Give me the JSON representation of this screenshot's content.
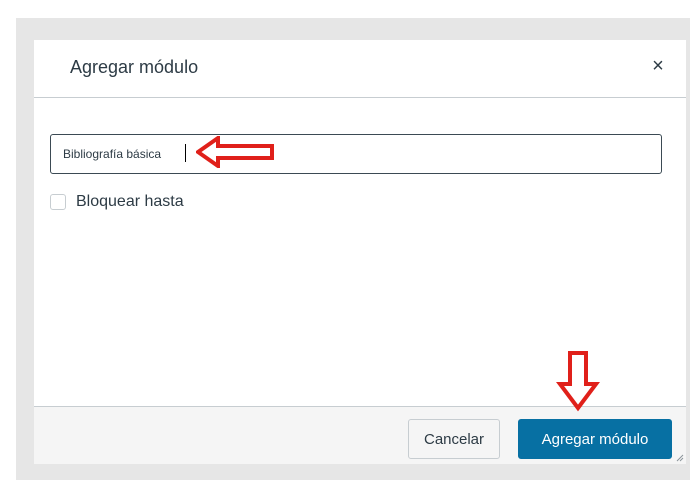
{
  "dialog": {
    "title": "Agregar módulo",
    "close_symbol": "×",
    "close_icon": "close-icon"
  },
  "form": {
    "module_name_value": "Bibliografía básica",
    "lock_until_label": "Bloquear hasta",
    "lock_until_checked": false
  },
  "footer": {
    "cancel_label": "Cancelar",
    "submit_label": "Agregar módulo"
  },
  "annotations": {
    "arrow_icons": [
      "left-arrow-icon",
      "down-arrow-icon"
    ],
    "arrow_color": "#e0201a"
  },
  "colors": {
    "primary_button": "#0770a3",
    "backdrop": "#e6e6e6",
    "text": "#2d3b45"
  }
}
